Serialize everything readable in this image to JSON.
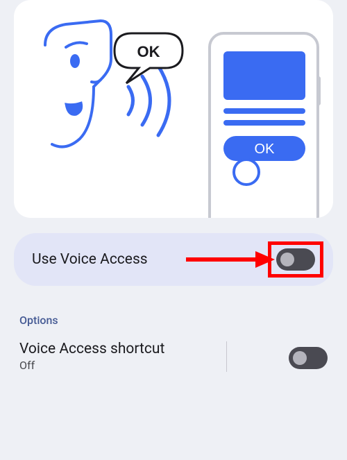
{
  "hero": {
    "bubble_text": "OK",
    "button_text": "OK"
  },
  "main_toggle": {
    "label": "Use Voice Access",
    "state": "off"
  },
  "section_header": "Options",
  "shortcut": {
    "title": "Voice Access shortcut",
    "status": "Off",
    "state": "off"
  },
  "annotation": {
    "highlight_target": "use-voice-access-switch",
    "highlight_color": "#ff0000"
  }
}
